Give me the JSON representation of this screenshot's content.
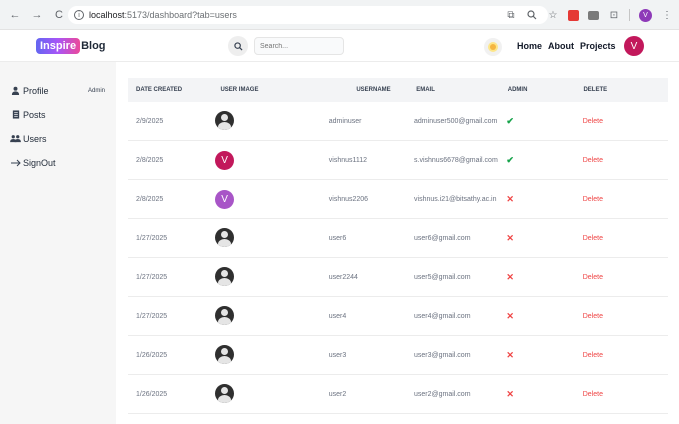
{
  "browser": {
    "url_host": "localhost",
    "url_path": ":5173/dashboard?tab=users",
    "profile_initial": "V"
  },
  "header": {
    "logo_badge": "Inspire",
    "logo_text": "Blog",
    "search_placeholder": "Search...",
    "nav": [
      "Home",
      "About",
      "Projects"
    ],
    "avatar_initial": "V"
  },
  "sidebar": {
    "items": [
      {
        "label": "Profile",
        "icon": "user-icon"
      },
      {
        "label": "Posts",
        "icon": "document-icon"
      },
      {
        "label": "Users",
        "icon": "users-icon"
      },
      {
        "label": "SignOut",
        "icon": "arrow-right-icon"
      }
    ],
    "admin_tag": "Admin"
  },
  "table": {
    "headers": [
      "Date created",
      "User image",
      "Username",
      "Email",
      "Admin",
      "Delete"
    ],
    "rows": [
      {
        "date": "2/9/2025",
        "avatar": "generic",
        "username": "adminuser",
        "email": "adminuser500@gmail.com",
        "admin": true,
        "delete": "Delete"
      },
      {
        "date": "2/8/2025",
        "avatar": "V",
        "avatar_color": "#c2185b",
        "username": "vishnus1112",
        "email": "s.vishnus6678@gmail.com",
        "admin": true,
        "delete": "Delete"
      },
      {
        "date": "2/8/2025",
        "avatar": "V",
        "avatar_color": "#a855c7",
        "username": "vishnus2206",
        "email": "vishnus.i21@bitsathy.ac.in",
        "admin": false,
        "delete": "Delete"
      },
      {
        "date": "1/27/2025",
        "avatar": "generic",
        "username": "user6",
        "email": "user6@gmail.com",
        "admin": false,
        "delete": "Delete"
      },
      {
        "date": "1/27/2025",
        "avatar": "generic",
        "username": "user2244",
        "email": "user5@gmail.com",
        "admin": false,
        "delete": "Delete"
      },
      {
        "date": "1/27/2025",
        "avatar": "generic",
        "username": "user4",
        "email": "user4@gmail.com",
        "admin": false,
        "delete": "Delete"
      },
      {
        "date": "1/26/2025",
        "avatar": "generic",
        "username": "user3",
        "email": "user3@gmail.com",
        "admin": false,
        "delete": "Delete"
      },
      {
        "date": "1/26/2025",
        "avatar": "generic",
        "username": "user2",
        "email": "user2@gmail.com",
        "admin": false,
        "delete": "Delete"
      }
    ]
  },
  "colors": {
    "accent": "#a855f7",
    "check": "#16a34a",
    "cross": "#ef4444",
    "delete": "#ef4444"
  }
}
